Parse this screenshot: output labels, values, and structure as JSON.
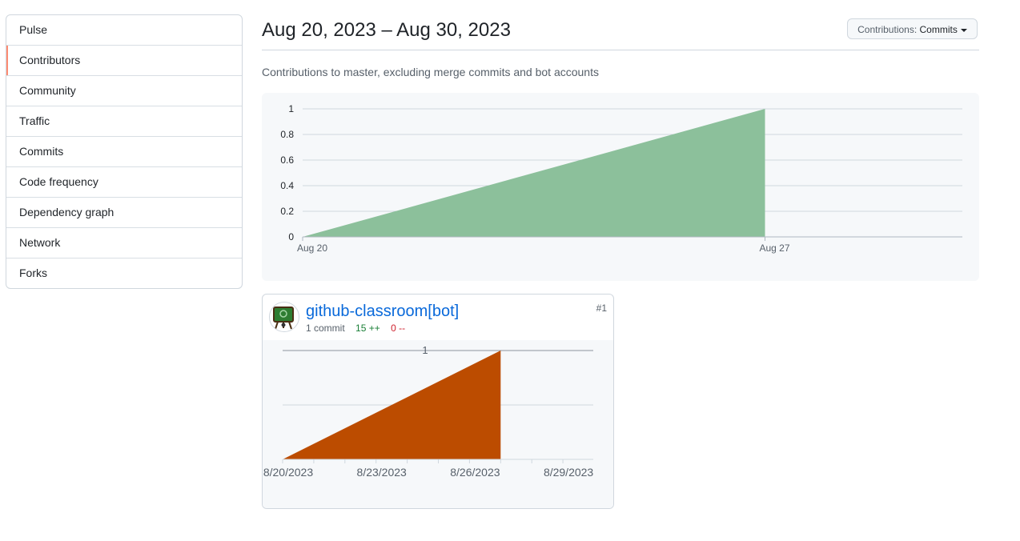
{
  "sidebar": {
    "items": [
      {
        "label": "Pulse"
      },
      {
        "label": "Contributors",
        "selected": true
      },
      {
        "label": "Community"
      },
      {
        "label": "Traffic"
      },
      {
        "label": "Commits"
      },
      {
        "label": "Code frequency"
      },
      {
        "label": "Dependency graph"
      },
      {
        "label": "Network"
      },
      {
        "label": "Forks"
      }
    ]
  },
  "header": {
    "date_range": "Aug 20, 2023 – Aug 30, 2023",
    "contributions_label": "Contributions:",
    "contributions_value": "Commits",
    "subtitle": "Contributions to master, excluding merge commits and bot accounts"
  },
  "colors": {
    "main_area": "#8cc09b",
    "contributor_area": "#bc4c00",
    "selected_indicator": "#fd8c73",
    "link": "#0969da"
  },
  "chart_data": [
    {
      "type": "area",
      "x": [
        "Aug 20",
        "Aug 27"
      ],
      "y": [
        0,
        1
      ],
      "x_tick_labels": [
        "Aug 20",
        "Aug 27"
      ],
      "y_ticks": [
        "0",
        "0.2",
        "0.4",
        "0.6",
        "0.8",
        "1"
      ],
      "ylim": [
        0,
        1
      ],
      "grid": true
    },
    {
      "type": "area",
      "x": [
        "8/20/2023",
        "8/27/2023"
      ],
      "y": [
        0,
        1
      ],
      "x_tick_labels": [
        "8/20/2023",
        "8/23/2023",
        "8/26/2023",
        "8/29/2023"
      ],
      "y_ticks": [
        "1"
      ],
      "ylim": [
        0,
        1
      ],
      "grid": true
    }
  ],
  "contributor": {
    "name": "github-classroom[bot]",
    "commits": "1 commit",
    "additions": "15 ++",
    "deletions": "0 --",
    "rank": "#1",
    "avatar_icon": "classroom-easel-icon"
  }
}
